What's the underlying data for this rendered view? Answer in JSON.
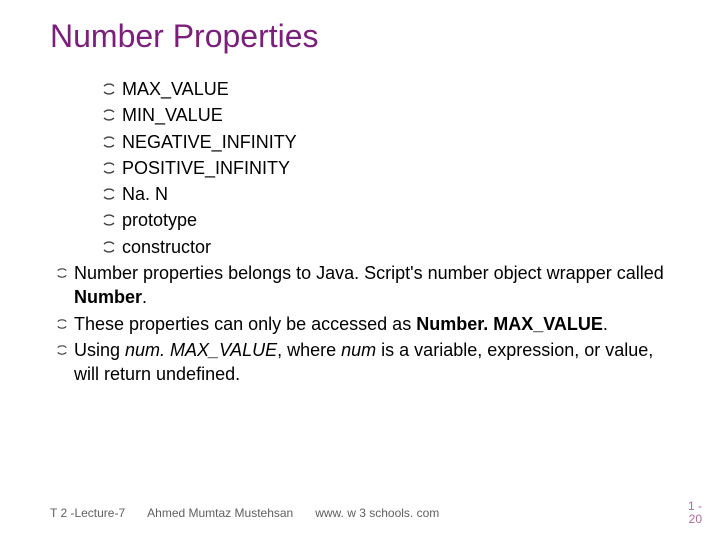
{
  "title": "Number Properties",
  "items": [
    "MAX_VALUE",
    "MIN_VALUE",
    "NEGATIVE_INFINITY",
    "POSITIVE_INFINITY",
    "Na. N",
    "prototype",
    "constructor"
  ],
  "paras": {
    "p1a": "Number properties belongs to Java. Script's number object wrapper called ",
    "p1b": "Number",
    "p1c": ".",
    "p2a": "These properties can only be accessed as ",
    "p2b": "Number. MAX_VALUE",
    "p2c": ".",
    "p3a": "Using ",
    "p3b": "num. MAX_VALUE",
    "p3c": ", where ",
    "p3d": "num ",
    "p3e": "is a variable, expression, or value, will return undefined."
  },
  "footer": {
    "left": "T 2 -Lecture-7",
    "mid": "Ahmed Mumtaz Mustehsan",
    "right": "www. w 3 schools. com"
  },
  "page": {
    "top": "1 -",
    "bot": "20"
  }
}
